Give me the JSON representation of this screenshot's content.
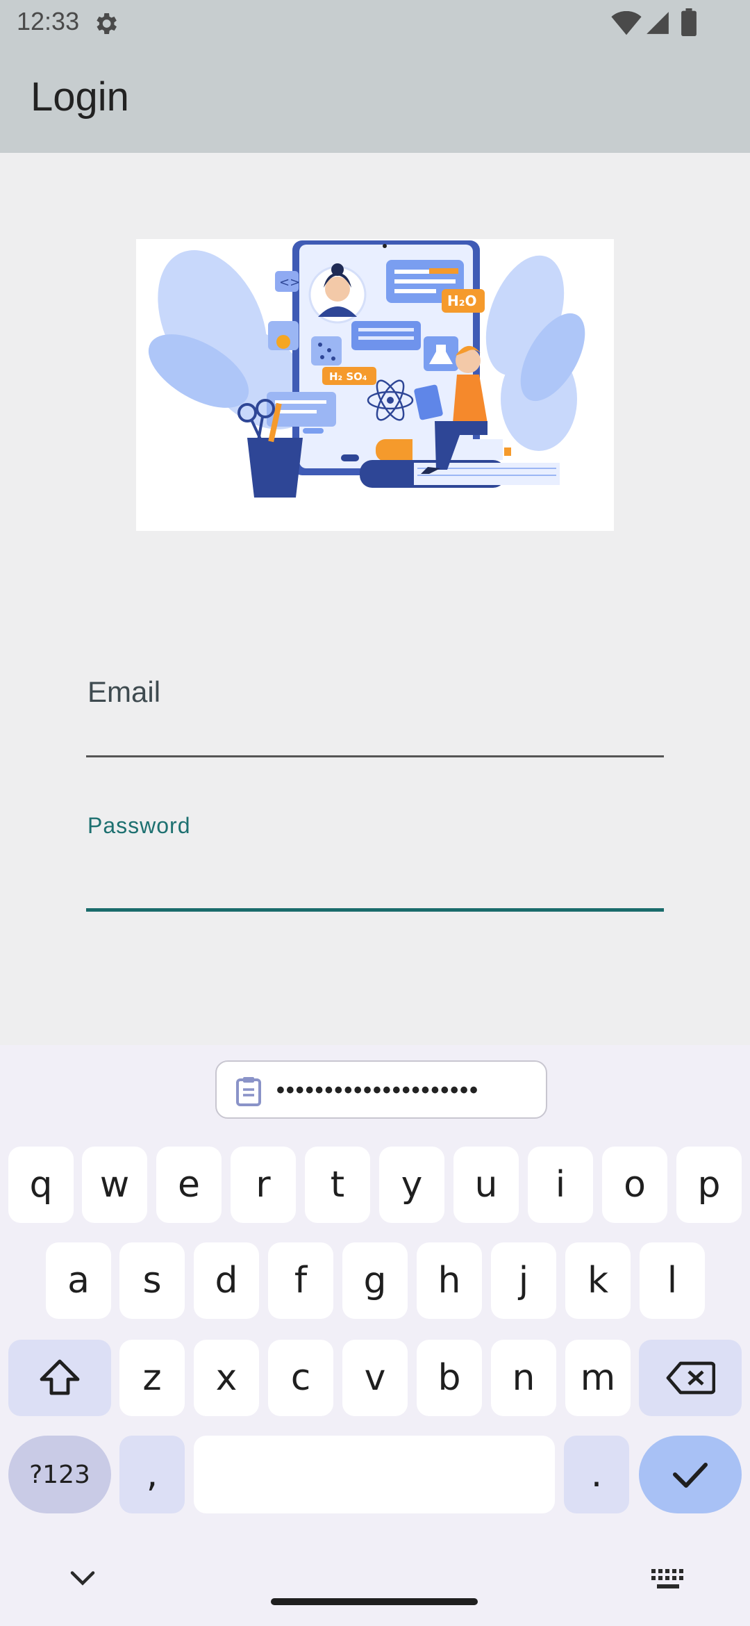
{
  "status_bar": {
    "time": "12:33",
    "icons": [
      "settings-gear-icon",
      "wifi-icon",
      "signal-icon",
      "battery-icon"
    ]
  },
  "app_bar": {
    "title": "Login"
  },
  "hero_image": {
    "icon": "education-illustration",
    "labels": [
      "H₂O",
      "H₂ SO₄"
    ]
  },
  "form": {
    "email": {
      "label": "Email",
      "value": ""
    },
    "password": {
      "label": "Password",
      "value": ""
    }
  },
  "keyboard": {
    "clipboard_suggestion": "•••••••••••••••••••••",
    "row1": [
      "q",
      "w",
      "e",
      "r",
      "t",
      "y",
      "u",
      "i",
      "o",
      "p"
    ],
    "row2": [
      "a",
      "s",
      "d",
      "f",
      "g",
      "h",
      "j",
      "k",
      "l"
    ],
    "row3": [
      "z",
      "x",
      "c",
      "v",
      "b",
      "n",
      "m"
    ],
    "symbols_key": "?123",
    "comma_key": ",",
    "period_key": ".",
    "space_key": ""
  },
  "colors": {
    "accent": "#1a6b6b",
    "app_bar": "#c7cdcf",
    "key_func": "#dcdff5",
    "enter_key": "#a8c1f5"
  }
}
